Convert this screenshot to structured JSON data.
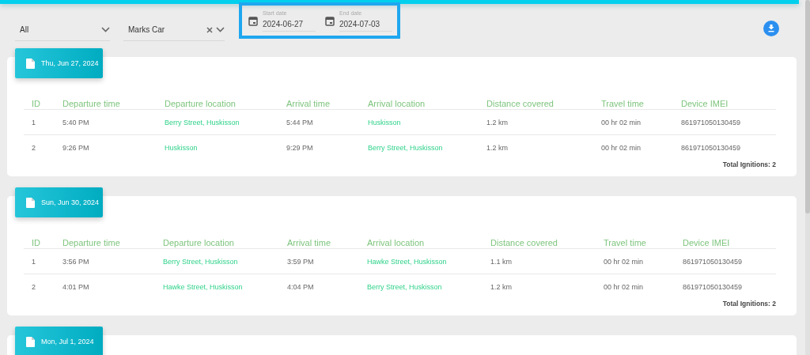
{
  "filters": {
    "type_select": {
      "value": "All"
    },
    "vehicle_select": {
      "value": "Marks Car"
    },
    "date_range": {
      "start": {
        "label": "Start date",
        "value": "2024-06-27"
      },
      "end": {
        "label": "End date",
        "value": "2024-07-03"
      }
    }
  },
  "days": [
    {
      "date": "Thu, Jun 27, 2024",
      "columns": [
        "ID",
        "Departure time",
        "Departure location",
        "Arrival time",
        "Arrival location",
        "Distance covered",
        "Travel time",
        "Device IMEI"
      ],
      "rows": [
        {
          "id": "1",
          "departure_time": "5:40 PM",
          "departure_location": "Berry Street, Huskisson",
          "arrival_time": "5:44 PM",
          "arrival_location": "Huskisson",
          "distance": "1.2 km",
          "travel_time": "00 hr 02 min",
          "imei": "861971050130459"
        },
        {
          "id": "2",
          "departure_time": "9:26 PM",
          "departure_location": "Huskisson",
          "arrival_time": "9:29 PM",
          "arrival_location": "Berry Street, Huskisson",
          "distance": "1.2 km",
          "travel_time": "00 hr 02 min",
          "imei": "861971050130459"
        }
      ],
      "total": "Total Ignitions: 2"
    },
    {
      "date": "Sun, Jun 30, 2024",
      "columns": [
        "ID",
        "Departure time",
        "Departure location",
        "Arrival time",
        "Arrival location",
        "Distance covered",
        "Travel time",
        "Device IMEI"
      ],
      "rows": [
        {
          "id": "1",
          "departure_time": "3:56 PM",
          "departure_location": "Berry Street, Huskisson",
          "arrival_time": "3:59 PM",
          "arrival_location": "Hawke Street, Huskisson",
          "distance": "1.1 km",
          "travel_time": "00 hr 02 min",
          "imei": "861971050130459"
        },
        {
          "id": "2",
          "departure_time": "4:01 PM",
          "departure_location": "Hawke Street, Huskisson",
          "arrival_time": "4:04 PM",
          "arrival_location": "Berry Street, Huskisson",
          "distance": "1.2 km",
          "travel_time": "00 hr 02 min",
          "imei": "861971050130459"
        }
      ],
      "total": "Total Ignitions: 2"
    },
    {
      "date": "Mon, Jul 1, 2024"
    }
  ]
}
